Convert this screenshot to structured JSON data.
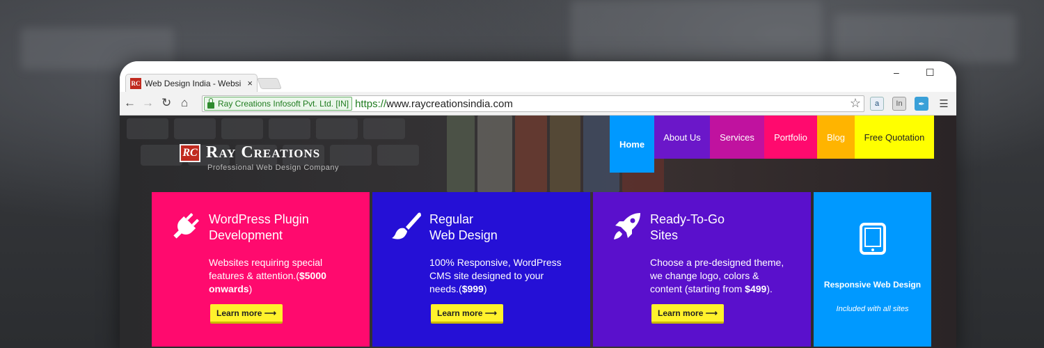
{
  "browser": {
    "tab_title": "Web Design India - Websi",
    "favicon_text": "RC",
    "tab_close": "×",
    "window_controls": {
      "minimize": "–",
      "maximize": "☐"
    },
    "ev_badge": "Ray Creations Infosoft Pvt. Ltd. [IN]",
    "url_scheme": "https://",
    "url_host": "www.raycreationsindia.com",
    "nav_icons": [
      "back-arrow-icon",
      "forward-arrow-icon",
      "reload-icon",
      "home-icon"
    ],
    "extension_icons": [
      "amazon-assistant-icon",
      "linkedin-icon",
      "feather-icon",
      "menu-icon"
    ]
  },
  "site": {
    "logo_mark": "RC",
    "logo_name": "Ray Creations",
    "logo_tagline": "Professional Web Design Company",
    "nav": [
      {
        "label": "Home",
        "color": "#0099ff",
        "active": true
      },
      {
        "label": "About Us",
        "color": "#6b17c9"
      },
      {
        "label": "Services",
        "color": "#c0129f"
      },
      {
        "label": "Portfolio",
        "color": "#ff0a6e"
      },
      {
        "label": "Blog",
        "color": "#ffb400"
      },
      {
        "label": "Free Quotation",
        "color": "#ffff00",
        "text_color": "#222222"
      }
    ],
    "cards": [
      {
        "icon": "plug-icon",
        "color": "#ff0a6e",
        "title_line1": "WordPress Plugin",
        "title_line2": "Development",
        "desc_text": "Websites requiring special features & attention.(",
        "desc_bold": "$5000 onwards",
        "desc_end": ")",
        "button": "Learn more ⟶"
      },
      {
        "icon": "paintbrush-icon",
        "color": "#2510d6",
        "title_line1": "Regular",
        "title_line2": "Web Design",
        "desc_text": "100% Responsive, WordPress CMS site designed to your needs.(",
        "desc_bold": "$999",
        "desc_end": ")",
        "button": "Learn more ⟶"
      },
      {
        "icon": "rocket-icon",
        "color": "#5a10cc",
        "title_line1": "Ready-To-Go",
        "title_line2": "Sites",
        "desc_text": "Choose a pre-designed theme, we change logo, colors & content (starting from ",
        "desc_bold": "$499",
        "desc_end": ").",
        "button": "Learn more ⟶"
      }
    ],
    "responsive": {
      "icon": "tablet-icon",
      "title": "Responsive Web Design",
      "subtitle": "Included with all sites"
    }
  }
}
